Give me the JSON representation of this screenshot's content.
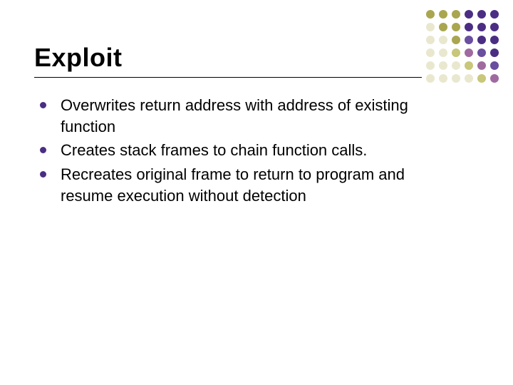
{
  "slide": {
    "title": "Exploit",
    "bullets": [
      "Overwrites return address with address of existing function",
      "Creates stack frames to chain function calls.",
      "Recreates original frame to return to program and resume execution without detection"
    ]
  }
}
